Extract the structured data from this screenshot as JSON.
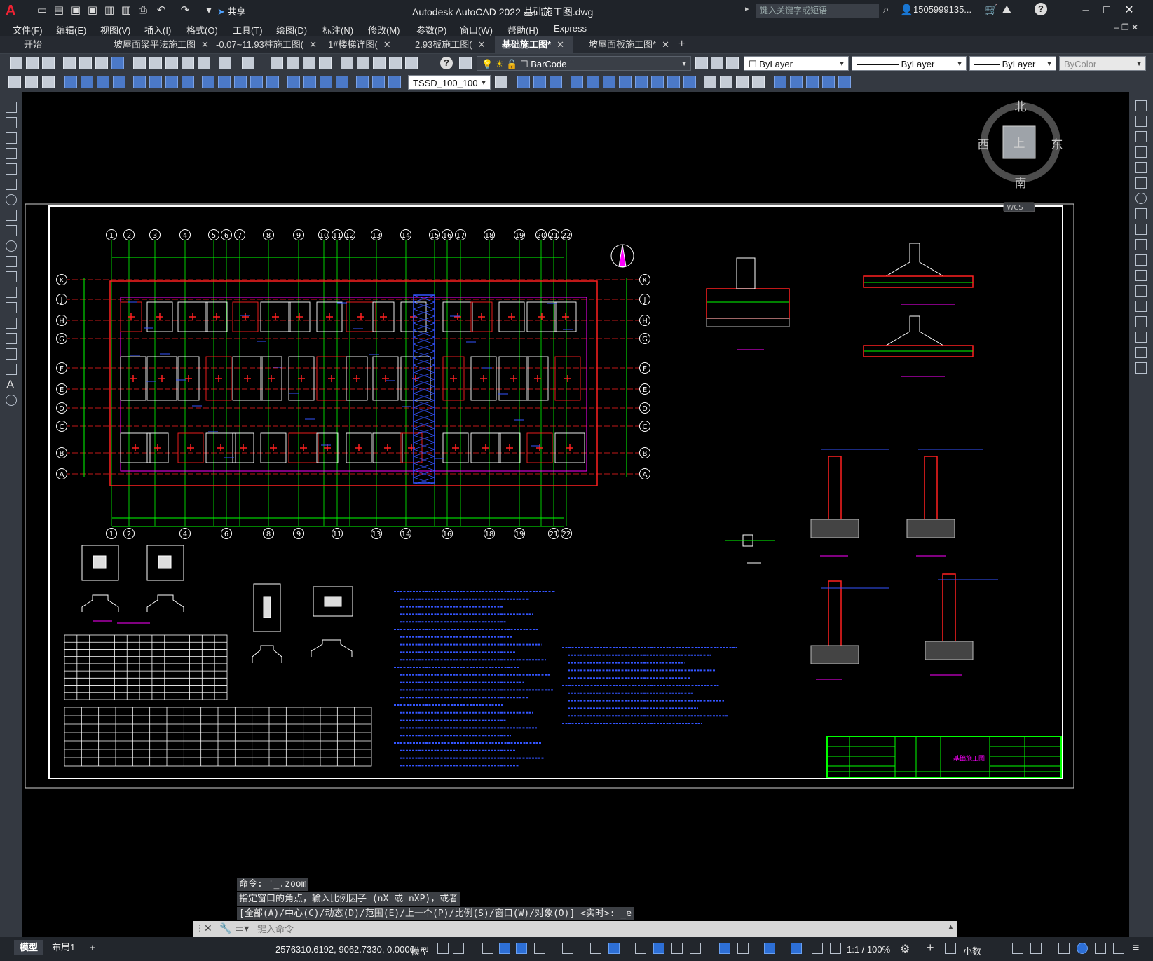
{
  "app": {
    "title": "Autodesk AutoCAD 2022    基础施工图.dwg",
    "share_label": "共享",
    "search_placeholder": "键入关键字或短语",
    "user": "1505999135...",
    "logo_letter": "A"
  },
  "menu": [
    "文件(F)",
    "编辑(E)",
    "视图(V)",
    "插入(I)",
    "格式(O)",
    "工具(T)",
    "绘图(D)",
    "标注(N)",
    "修改(M)",
    "参数(P)",
    "窗口(W)",
    "帮助(H)",
    "Express"
  ],
  "tabs": [
    {
      "label": "开始",
      "active": false,
      "closable": false
    },
    {
      "label": "坡屋面梁平法施工图",
      "active": false,
      "closable": true
    },
    {
      "label": "-0.07~11.93柱施工图(",
      "active": false,
      "closable": true
    },
    {
      "label": "1#楼梯详图(",
      "active": false,
      "closable": true
    },
    {
      "label": "2.93板施工图(",
      "active": false,
      "closable": true
    },
    {
      "label": "基础施工图*",
      "active": true,
      "closable": true
    },
    {
      "label": "坡屋面板施工图*",
      "active": false,
      "closable": true
    }
  ],
  "toolbar": {
    "layer_name": "BarCode",
    "color": "ByLayer",
    "linetype": "ByLayer",
    "lineweight": "ByLayer",
    "plotstyle": "ByColor",
    "dim_style": "TSSD_100_100"
  },
  "viewcube": {
    "north": "北",
    "south": "南",
    "east": "东",
    "west": "西",
    "top": "上",
    "wcs": "WCS"
  },
  "drawing": {
    "axis_top": [
      "1",
      "2",
      "3",
      "4",
      "5",
      "6",
      "7",
      "8",
      "9",
      "10",
      "11",
      "12",
      "13",
      "14",
      "15",
      "16",
      "17",
      "18",
      "19",
      "20",
      "21",
      "22"
    ],
    "axis_bottom": [
      "1",
      "2",
      "4",
      "6",
      "8",
      "9",
      "11",
      "13",
      "14",
      "16",
      "18",
      "19",
      "21",
      "22"
    ],
    "axis_rows": [
      "K",
      "J",
      "H",
      "G",
      "F",
      "E",
      "D",
      "C",
      "B",
      "A"
    ],
    "title_block_label": "基础施工图"
  },
  "command": {
    "history": [
      "命令: '_.zoom",
      "指定窗口的角点，输入比例因子 (nX 或 nXP)，或者",
      "[全部(A)/中心(C)/动态(D)/范围(E)/上一个(P)/比例(S)/窗口(W)/对象(O)] <实时>: _e"
    ],
    "placeholder": "键入命令"
  },
  "status": {
    "layouts": [
      {
        "label": "模型",
        "active": true
      },
      {
        "label": "布局1",
        "active": false
      }
    ],
    "add_layout": "+",
    "coords": "2576310.6192, 9062.7330, 0.0000",
    "model_label": "模型",
    "scale": "1:1 / 100%",
    "units": "小数"
  },
  "colors": {
    "accent": "#2d6fd6",
    "green": "#00ff00",
    "red": "#ff2020",
    "magenta": "#ff00ff",
    "blue": "#3355ff"
  }
}
